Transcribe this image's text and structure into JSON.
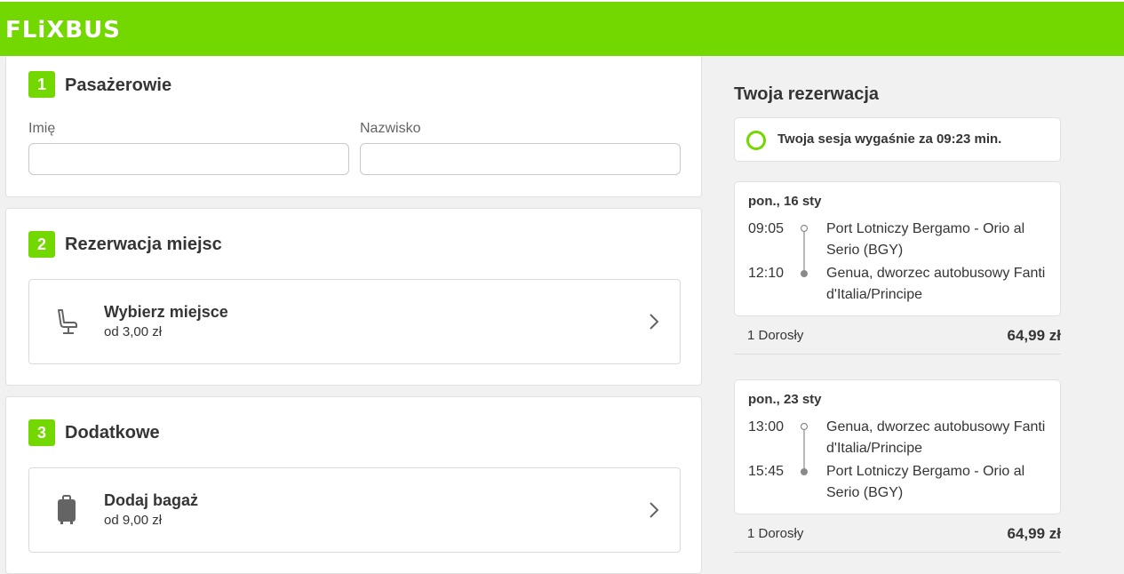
{
  "brand": {
    "logo_text": "FLiXBUS",
    "accent_color": "#73d700"
  },
  "form": {
    "passengers": {
      "step_number": "1",
      "title": "Pasażerowie",
      "first_name_label": "Imię",
      "first_name_value": "",
      "last_name_label": "Nazwisko",
      "last_name_value": ""
    },
    "seats": {
      "step_number": "2",
      "title": "Rezerwacja miejsc",
      "option_title": "Wybierz miejsce",
      "option_price": "od 3,00 zł",
      "icon": "seat-icon"
    },
    "extras": {
      "step_number": "3",
      "title": "Dodatkowe",
      "option_title": "Dodaj bagaż",
      "option_price": "od 9,00 zł",
      "icon": "luggage-icon"
    }
  },
  "summary": {
    "title": "Twoja rezerwacja",
    "session_text": "Twoja sesja wygaśnie za 09:23 min.",
    "trips": [
      {
        "date": "pon., 16 sty",
        "departure_time": "09:05",
        "departure_stop": "Port Lotniczy Bergamo - Orio al Serio (BGY)",
        "arrival_time": "12:10",
        "arrival_stop": "Genua, dworzec autobusowy Fanti d'Italia/Principe",
        "passengers": "1 Dorosły",
        "price": "64,99 zł"
      },
      {
        "date": "pon., 23 sty",
        "departure_time": "13:00",
        "departure_stop": "Genua, dworzec autobusowy Fanti d'Italia/Principe",
        "arrival_time": "15:45",
        "arrival_stop": "Port Lotniczy Bergamo - Orio al Serio (BGY)",
        "passengers": "1 Dorosły",
        "price": "64,99 zł"
      }
    ]
  }
}
